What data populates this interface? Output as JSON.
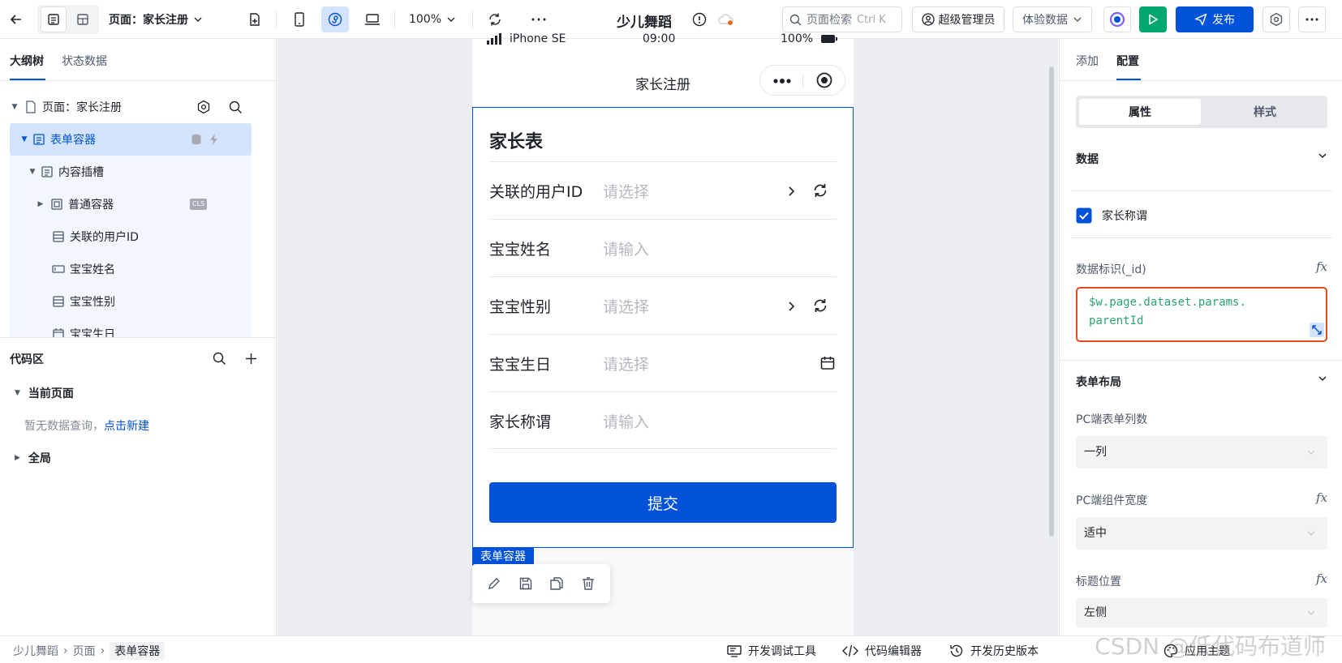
{
  "topbar": {
    "page_selector": "页面：家长注册",
    "zoom": "100%",
    "app_title": "少儿舞蹈",
    "search_placeholder": "页面检索",
    "search_shortcut": "Ctrl K",
    "user_role": "超级管理员",
    "data_mode": "体验数据",
    "publish": "发布"
  },
  "left": {
    "tabs": [
      "大纲树",
      "状态数据"
    ],
    "tree": {
      "page": "页面：家长注册",
      "form_container": "表单容器",
      "content_slot": "内容插槽",
      "normal_container": "普通容器",
      "cls_badge": "CLS",
      "items": [
        "关联的用户ID",
        "宝宝姓名",
        "宝宝性别",
        "宝宝生日"
      ]
    },
    "code": {
      "title": "代码区",
      "current_page": "当前页面",
      "empty_text": "暂无数据查询，",
      "create_link": "点击新建",
      "global": "全局"
    }
  },
  "phone": {
    "carrier": "iPhone SE",
    "time": "09:00",
    "battery": "100%",
    "nav_title": "家长注册",
    "form_title": "家长表",
    "fields": [
      {
        "label": "关联的用户ID",
        "placeholder": "请选择"
      },
      {
        "label": "宝宝姓名",
        "placeholder": "请输入"
      },
      {
        "label": "宝宝性别",
        "placeholder": "请选择"
      },
      {
        "label": "宝宝生日",
        "placeholder": "请选择"
      },
      {
        "label": "家长称谓",
        "placeholder": "请输入"
      }
    ],
    "submit": "提交",
    "selection_tag": "表单容器"
  },
  "right": {
    "tabs": [
      "添加",
      "配置"
    ],
    "segments": [
      "属性",
      "样式"
    ],
    "data_section": "数据",
    "checkbox_label": "家长称谓",
    "id_label": "数据标识(_id)",
    "id_value_line1": "$w.page.dataset.params.",
    "id_value_line2": "parentId",
    "layout_section": "表单布局",
    "pc_columns_label": "PC端表单列数",
    "pc_columns_value": "一列",
    "pc_width_label": "PC端组件宽度",
    "pc_width_value": "适中",
    "title_pos_label": "标题位置",
    "title_pos_value": "左侧",
    "fx": "fx"
  },
  "bottom": {
    "breadcrumb": [
      "少儿舞蹈",
      "页面",
      "表单容器"
    ],
    "debug_tools": "开发调试工具",
    "code_editor": "代码编辑器",
    "history": "开发历史版本",
    "theme": "应用主题"
  },
  "watermark": "CSDN @低代码布道师",
  "colors": {
    "brand": "#0052d9",
    "publish": "#0052d9",
    "run": "#00a870",
    "error_border": "#e34d1f",
    "code_text": "#2ba471"
  }
}
